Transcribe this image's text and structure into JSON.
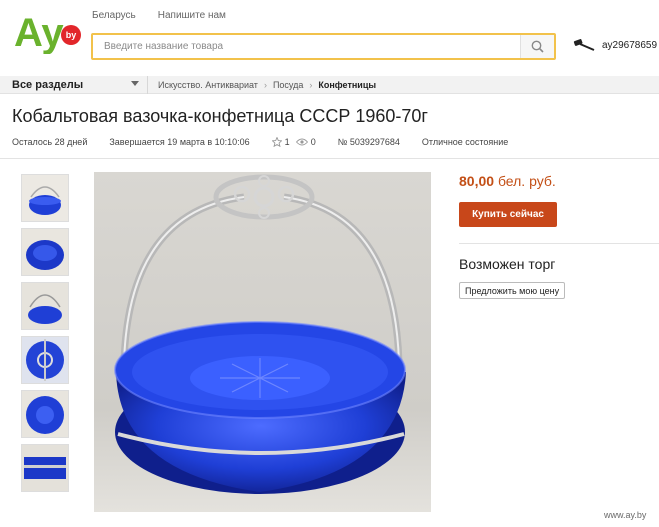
{
  "header": {
    "logo": {
      "text": "Ay",
      "badge": "by",
      "color": "#6ab22d",
      "badge_color": "#e2262a"
    },
    "links": [
      "Беларусь",
      "Напишите нам"
    ],
    "search": {
      "placeholder": "Введите название товара",
      "value": ""
    },
    "user": {
      "name": "ay29678659",
      "icon": "gavel-icon"
    }
  },
  "catbar": {
    "all_sections": "Все разделы",
    "breadcrumbs": [
      "Искусство. Антиквариат",
      "Посуда",
      "Конфетницы"
    ],
    "separator": "›"
  },
  "lot": {
    "title": "Кобальтовая вазочка-конфетница СССР 1960-70г",
    "remaining": "Осталось 28 дней",
    "ends": "Завершается 19 марта в 10:10:06",
    "watchers": "1",
    "views": "0",
    "number": "№ 5039297684",
    "condition": "Отличное состояние"
  },
  "gallery": {
    "thumbnail_count": 6,
    "glass_color": "#1f3fd6"
  },
  "offer_panel": {
    "price": "80,00",
    "currency": "бел. руб.",
    "buy_label": "Купить сейчас",
    "bargain_title": "Возможен торг",
    "propose_label": "Предложить мою цену",
    "accent": "#c8471a"
  },
  "watermark": "www.ay.by"
}
